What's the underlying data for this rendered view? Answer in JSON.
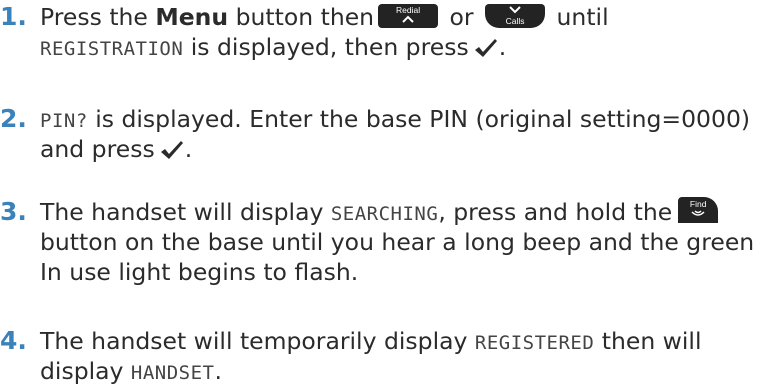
{
  "steps": [
    {
      "number": "1.",
      "pre": "Press the ",
      "menu": "Menu",
      "mid": " button then",
      "key_redial": "Redial",
      "or": " or ",
      "key_calls": "Calls",
      "until": " until",
      "display_text": "REGISTRATION",
      "rest": " is displayed, then press"
    },
    {
      "number": "2.",
      "display_text": "PIN?",
      "rest": " is displayed. Enter the base PIN (original setting=0000)",
      "line2": "and press"
    },
    {
      "number": "3.",
      "pre": "The handset will display ",
      "display_text": "SEARCHING",
      "mid": ", press and hold the",
      "key_find": "Find",
      "line2": "button on the base until you hear a long beep and the green",
      "line3": "In use light begins to flash."
    },
    {
      "number": "4.",
      "pre": "The handset will temporarily display ",
      "display_text": "REGISTERED",
      "mid": " then will",
      "line2_pre": "display ",
      "display_text2": "HANDSET",
      "line2_end": "."
    }
  ],
  "icons": {
    "check": "checkmark-icon",
    "redial": "chevron-up-icon",
    "calls": "chevron-down-icon",
    "find": "wave-icon"
  },
  "colors": {
    "number": "#3a82b9",
    "key": "#232323"
  }
}
